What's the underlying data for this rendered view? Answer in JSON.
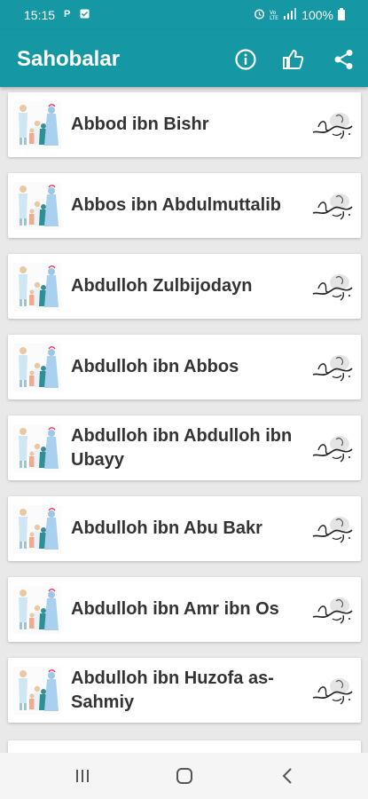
{
  "status_bar": {
    "time": "15:15",
    "battery": "100%",
    "icons": [
      "p-icon",
      "message-icon",
      "alarm-icon",
      "vowifi-icon",
      "signal-icon",
      "battery-icon"
    ]
  },
  "app_bar": {
    "title": "Sahobalar",
    "actions": [
      "info-icon",
      "thumbs-up-icon",
      "share-icon"
    ]
  },
  "items": [
    {
      "name": "Abbod ibn Bishr"
    },
    {
      "name": "Abbos ibn Abdulmuttalib"
    },
    {
      "name": "Abdulloh Zulbijodayn"
    },
    {
      "name": "Abdulloh ibn Abbos"
    },
    {
      "name": "Abdulloh ibn Abdulloh ibn Ubayy"
    },
    {
      "name": "Abdulloh ibn Abu Bakr"
    },
    {
      "name": "Abdulloh ibn Amr ibn Os"
    },
    {
      "name": "Abdulloh ibn Huzofa as-Sahmiy"
    }
  ],
  "colors": {
    "primary": "#1597a4",
    "background": "#e9e9e9",
    "card": "#ffffff",
    "text": "#333333"
  }
}
